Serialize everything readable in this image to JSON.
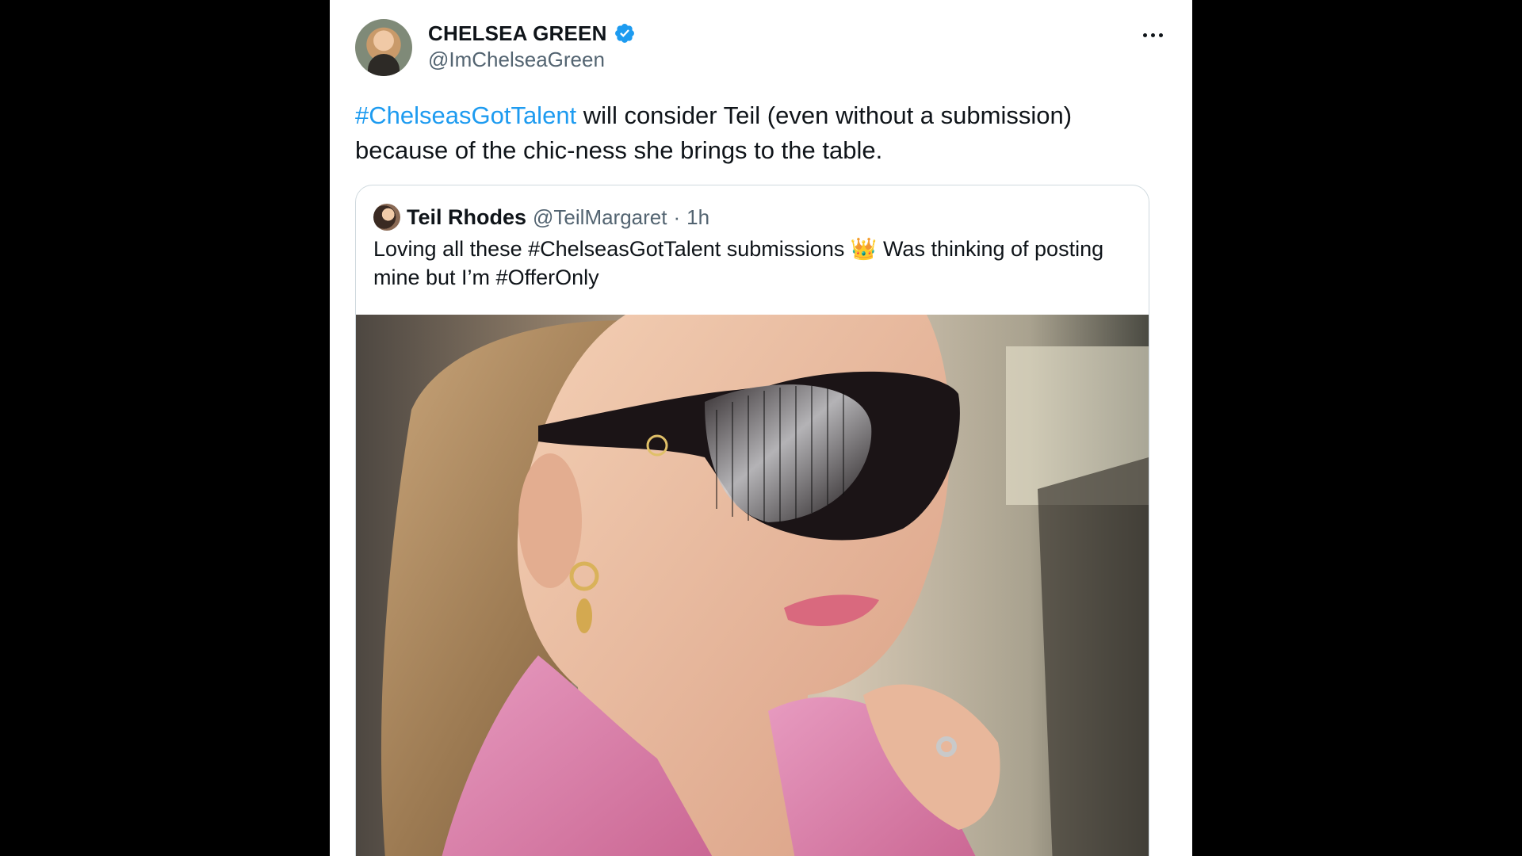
{
  "post": {
    "author": {
      "display_name": "CHELSEA GREEN",
      "handle": "@ImChelseaGreen"
    },
    "text": {
      "hashtag": "#ChelseasGotTalent",
      "body": " will consider Teil (even without a submission) because of the chic-ness she brings to the table."
    },
    "quoted": {
      "display_name": "Teil Rhodes",
      "handle": "@TeilMargaret",
      "separator": "·",
      "time": "1h",
      "text": "Loving all these #ChelseasGotTalent submissions 👑 Was thinking of posting mine but I’m #OfferOnly"
    }
  },
  "icons": {
    "verified": "verified-badge-icon",
    "more": "more-options-icon"
  },
  "colors": {
    "background": "#000000",
    "card": "#ffffff",
    "text_primary": "#0f1419",
    "text_secondary": "#536471",
    "link": "#1d9bf0",
    "verified": "#1d9bf0",
    "border": "#cfd9de"
  }
}
